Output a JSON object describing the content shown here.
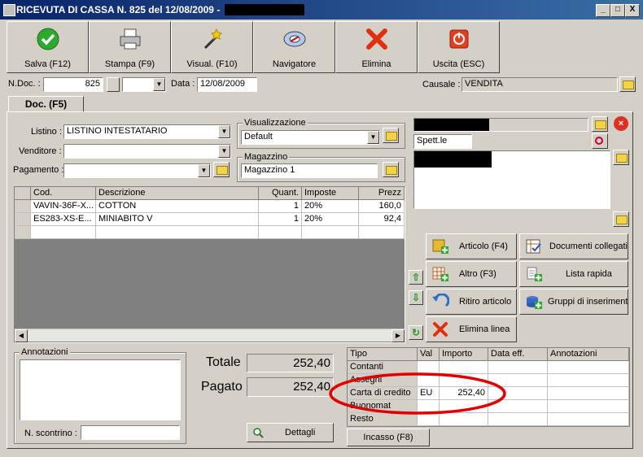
{
  "window": {
    "title": "RICEVUTA DI CASSA N. 825  del 12/08/2009 -",
    "minimize": "_",
    "maximize": "□",
    "close": "X"
  },
  "toolbar": [
    {
      "label": "Salva (F12)",
      "icon": "check-icon"
    },
    {
      "label": "Stampa (F9)",
      "icon": "printer-icon"
    },
    {
      "label": "Visual. (F10)",
      "icon": "magic-wand-icon"
    },
    {
      "label": "Navigatore",
      "icon": "compass-icon"
    },
    {
      "label": "Elimina",
      "icon": "delete-x-icon"
    },
    {
      "label": "Uscita (ESC)",
      "icon": "exit-icon"
    }
  ],
  "header": {
    "ndoc_label": "N.Doc. :",
    "ndoc_value": "825",
    "data_label": "Data :",
    "data_value": "12/08/2009",
    "causale_label": "Causale :",
    "causale_value": "VENDITA"
  },
  "tab": {
    "label": "Doc. (F5)"
  },
  "form": {
    "listino_label": "Listino :",
    "listino_value": "LISTINO INTESTATARIO",
    "venditore_label": "Venditore :",
    "venditore_value": "",
    "pagamento_label": "Pagamento :",
    "pagamento_value": "",
    "visualizzazione_label": "Visualizzazione",
    "visualizzazione_value": "Default",
    "magazzino_label": "Magazzino",
    "magazzino_value": "Magazzino 1"
  },
  "customer": {
    "spett_value": "Spett.le"
  },
  "grid": {
    "columns": [
      "Cod.",
      "Descrizione",
      "Quant.",
      "Imposte",
      "Prezz"
    ],
    "rows": [
      {
        "cod": "VAVIN-36F-X...",
        "descrizione": "COTTON",
        "quant": "1",
        "imposte": "20%",
        "prezzo": "160,0"
      },
      {
        "cod": "ES283-XS-E...",
        "descrizione": "MINIABITO V",
        "quant": "1",
        "imposte": "20%",
        "prezzo": "92,4"
      }
    ]
  },
  "actions": {
    "articolo": "Articolo (F4)",
    "documenti": "Documenti collegati",
    "altro": "Altro (F3)",
    "lista": "Lista rapida",
    "ritiro": "Ritiro articolo",
    "gruppi": "Gruppi di inserimento",
    "elimina_linea": "Elimina linea"
  },
  "notes": {
    "annotazioni_label": "Annotazioni",
    "scontrino_label": "N. scontrino :",
    "scontrino_value": ""
  },
  "totals": {
    "totale_label": "Totale",
    "totale_value": "252,40",
    "pagato_label": "Pagato",
    "pagato_value": "252,40",
    "dettagli_label": "Dettagli"
  },
  "payments": {
    "columns": [
      "Tipo",
      "Val",
      "Importo",
      "Data eff.",
      "Annotazioni"
    ],
    "rows": [
      {
        "tipo": "Contanti",
        "val": "",
        "importo": ""
      },
      {
        "tipo": "Assegni",
        "val": "",
        "importo": ""
      },
      {
        "tipo": "Carta di credito",
        "val": "EU",
        "importo": "252,40"
      },
      {
        "tipo": "Buonomat",
        "val": "",
        "importo": ""
      },
      {
        "tipo": "Resto",
        "val": "",
        "importo": ""
      }
    ],
    "incasso_label": "Incasso (F8)"
  },
  "colors": {
    "highlight_ellipse": "#e00000",
    "title_bar": "#0a246a"
  }
}
